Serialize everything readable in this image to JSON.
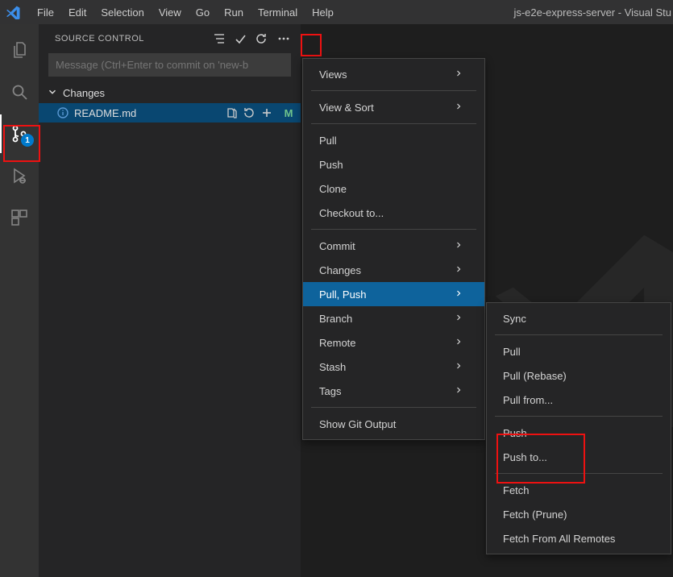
{
  "window": {
    "title": "js-e2e-express-server - Visual Stu"
  },
  "menubar": {
    "items": [
      "File",
      "Edit",
      "Selection",
      "View",
      "Go",
      "Run",
      "Terminal",
      "Help"
    ]
  },
  "activity": {
    "scm_badge": "1"
  },
  "sidebar": {
    "panel_title": "SOURCE CONTROL",
    "commit_placeholder": "Message (Ctrl+Enter to commit on 'new-b",
    "changes_label": "Changes",
    "file": {
      "name": "README.md",
      "status": "M"
    }
  },
  "menu1": {
    "views": "Views",
    "view_sort": "View & Sort",
    "pull": "Pull",
    "push": "Push",
    "clone": "Clone",
    "checkout": "Checkout to...",
    "commit": "Commit",
    "changes": "Changes",
    "pull_push": "Pull, Push",
    "branch": "Branch",
    "remote": "Remote",
    "stash": "Stash",
    "tags": "Tags",
    "show_git_output": "Show Git Output"
  },
  "menu2": {
    "sync": "Sync",
    "pull": "Pull",
    "pull_rebase": "Pull (Rebase)",
    "pull_from": "Pull from...",
    "push": "Push",
    "push_to": "Push to...",
    "fetch": "Fetch",
    "fetch_prune": "Fetch (Prune)",
    "fetch_all": "Fetch From All Remotes"
  }
}
